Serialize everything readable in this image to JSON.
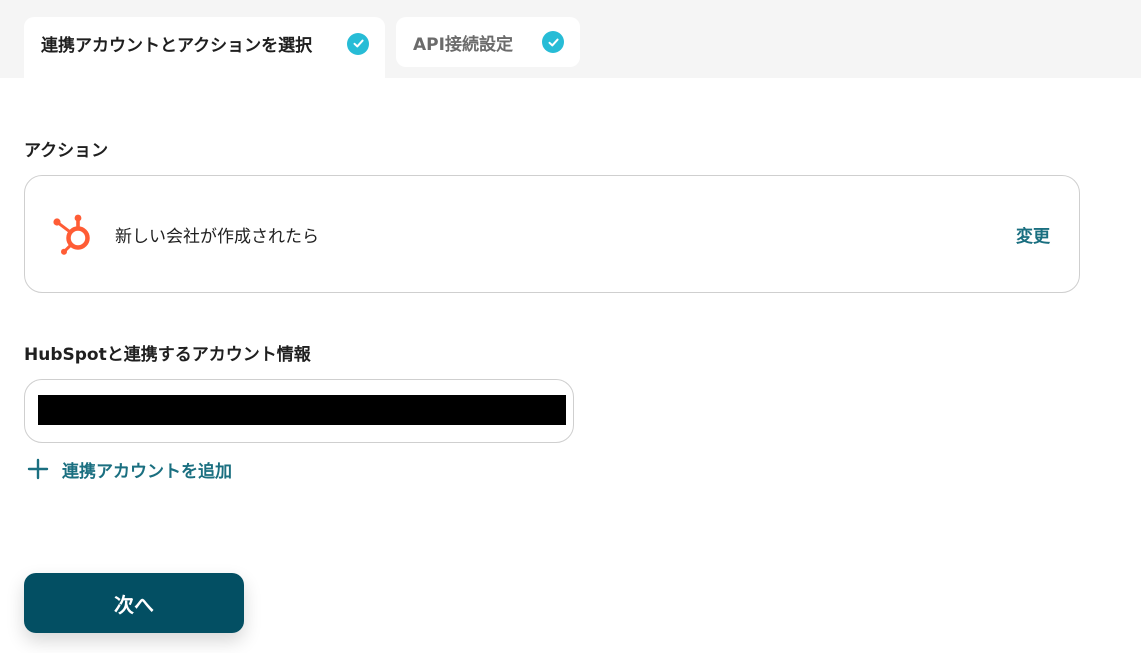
{
  "tabs": [
    {
      "label": "連携アカウントとアクションを選択",
      "completed": true,
      "active": true,
      "icon": "check-circle-icon"
    },
    {
      "label": "API接続設定",
      "completed": true,
      "active": false,
      "icon": "check-circle-icon"
    }
  ],
  "action_section": {
    "heading": "アクション",
    "app_icon": "hubspot-icon",
    "action_title": "新しい会社が作成されたら",
    "change_label": "変更"
  },
  "account_section": {
    "heading": "HubSpotと連携するアカウント情報",
    "value_redacted": true,
    "add_account_label": "連携アカウントを追加",
    "add_icon": "plus-icon"
  },
  "next_button": {
    "label": "次へ"
  },
  "colors": {
    "accent_teal": "#1a6f80",
    "check_cyan": "#27bcd6",
    "button_dark_teal": "#034f63",
    "hubspot_orange": "#ff5c35"
  }
}
